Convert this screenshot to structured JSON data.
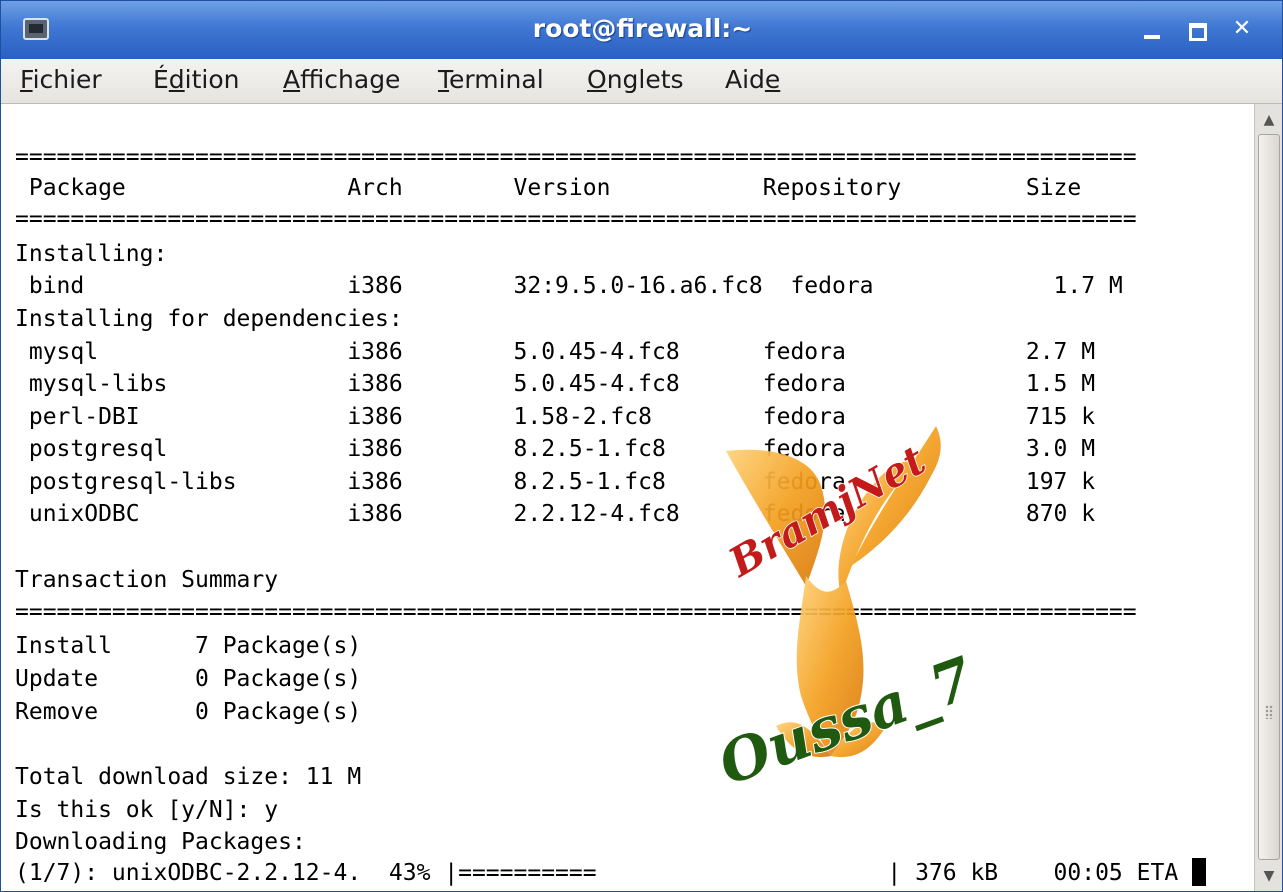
{
  "window": {
    "title": "root@firewall:~",
    "colors": {
      "titlebar": "#3f77d3",
      "menubar": "#e9e7e3",
      "terminal_bg": "#ffffff",
      "terminal_fg": "#000000",
      "watermark_orange": "#f4a020",
      "watermark_red": "#c31a1a",
      "watermark_green": "#1f5a10"
    },
    "controls": {
      "minimize_icon": "minimize-icon",
      "maximize_icon": "maximize-icon",
      "close_label": "✕"
    }
  },
  "menu": [
    {
      "label": "Fichier",
      "accel": "F",
      "rest": "ichier",
      "pre": ""
    },
    {
      "label": "Édition",
      "accel": "d",
      "rest": "ition",
      "pre": "É"
    },
    {
      "label": "Affichage",
      "accel": "A",
      "rest": "ffichage",
      "pre": ""
    },
    {
      "label": "Terminal",
      "accel": "T",
      "rest": "erminal",
      "pre": ""
    },
    {
      "label": "Onglets",
      "accel": "O",
      "rest": "nglets",
      "pre": ""
    },
    {
      "label": "Aide",
      "accel": "e",
      "rest": "",
      "pre": "Aid"
    }
  ],
  "terminal": {
    "lines": [
      "",
      "=================================================================================",
      " Package                Arch        Version           Repository         Size",
      "=================================================================================",
      "Installing:",
      " bind                   i386        32:9.5.0-16.a6.fc8  fedora             1.7 M",
      "Installing for dependencies:",
      " mysql                  i386        5.0.45-4.fc8      fedora             2.7 M",
      " mysql-libs             i386        5.0.45-4.fc8      fedora             1.5 M",
      " perl-DBI               i386        1.58-2.fc8        fedora             715 k",
      " postgresql             i386        8.2.5-1.fc8       fedora             3.0 M",
      " postgresql-libs        i386        8.2.5-1.fc8       fedora             197 k",
      " unixODBC               i386        2.2.12-4.fc8      fedora             870 k",
      "",
      "Transaction Summary",
      "=================================================================================",
      "Install      7 Package(s)",
      "Update       0 Package(s)",
      "Remove       0 Package(s)",
      "",
      "Total download size: 11 M",
      "Is this ok [y/N]: y",
      "Downloading Packages:",
      "(1/7): unixODBC-2.2.12-4.  43% |==========                     | 376 kB    00:05 ETA "
    ],
    "progress_fraction": 0.43
  },
  "watermark": {
    "top_text": "BramjNet",
    "bottom_text": "Oussa_7"
  }
}
